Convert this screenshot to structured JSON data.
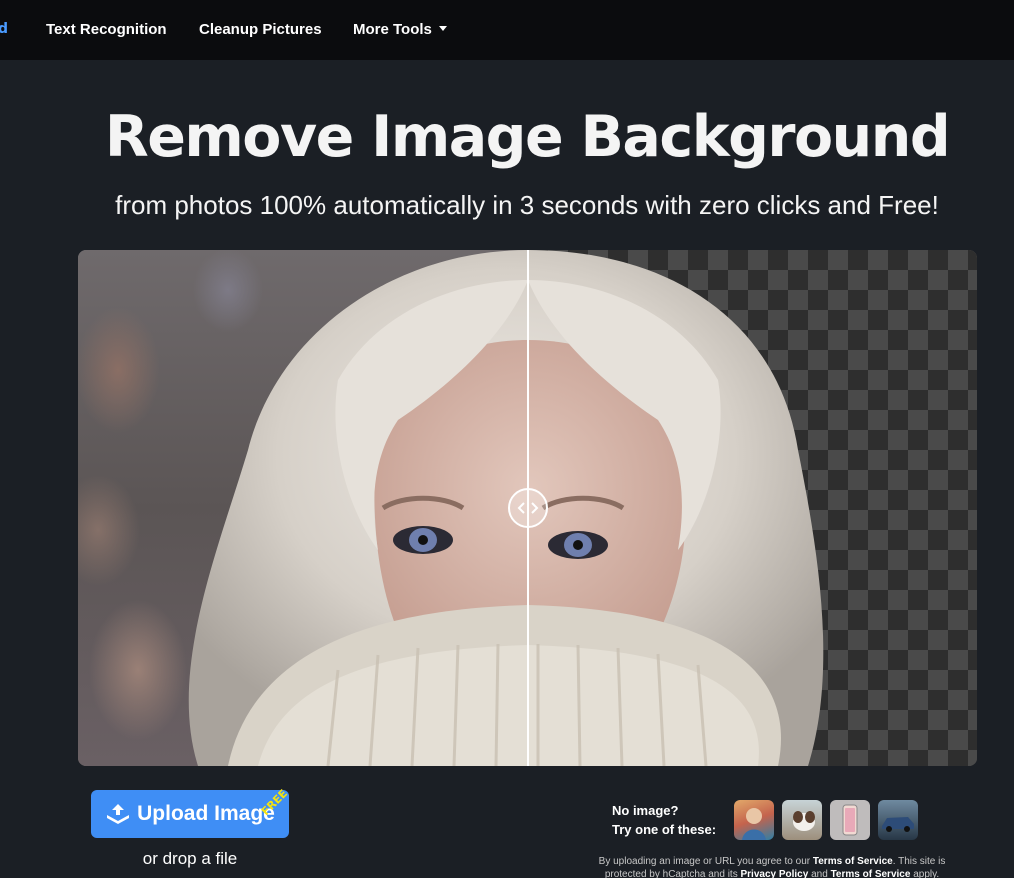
{
  "nav": {
    "cut_item": "d",
    "items": [
      {
        "label": "Text Recognition"
      },
      {
        "label": "Cleanup Pictures"
      },
      {
        "label": "More Tools"
      }
    ]
  },
  "hero": {
    "title": "Remove Image Background",
    "subtitle": "from photos 100% automatically in 3 seconds with zero clicks and Free!"
  },
  "upload": {
    "button_label": "Upload Image",
    "badge": "FREE",
    "drop_text": "or drop a file"
  },
  "samples": {
    "line1": "No image?",
    "line2": "Try one of these:"
  },
  "terms": {
    "prefix": "By uploading an image or URL you agree to our",
    "tos": "Terms of Service",
    "middle": ". This site is protected by hCaptcha and its",
    "privacy": "Privacy Policy",
    "and": "and",
    "tos2": "Terms of Service",
    "suffix": "apply."
  },
  "colors": {
    "accent": "#3f8ef5",
    "badge": "#f2e312",
    "background": "#1b1f25",
    "nav": "#0b0c0e"
  }
}
